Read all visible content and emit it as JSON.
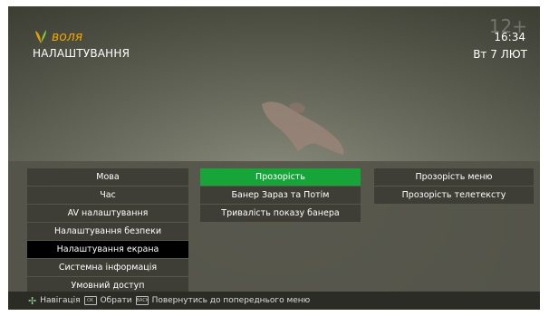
{
  "brand": {
    "name": "воля",
    "color": "#f0a500"
  },
  "header": {
    "title": "НАЛАШТУВАННЯ",
    "age_rating": "12+",
    "time": "16:34",
    "date": "Вт 7 ЛЮТ"
  },
  "menu": {
    "main_items": [
      "Мова",
      "Час",
      "AV налаштування",
      "Налаштування безпеки",
      "Налаштування екрана",
      "Системна інформація",
      "Умовний доступ"
    ],
    "main_selected_index": 4,
    "sub_items": [
      "Прозорість",
      "Банер Зараз та Потім",
      "Тривалість показу банера"
    ],
    "sub_active_index": 0,
    "detail_items": [
      "Прозорість меню",
      "Прозорість телетексту"
    ]
  },
  "help_bar": {
    "navigate_label": "Навігація",
    "ok_key": "OK",
    "select_label": "Обрати",
    "back_key": "BACK",
    "back_label": "Повернутись до попереднього меню"
  },
  "colors": {
    "active": "#17a53a",
    "selected": "#000000",
    "item_bg": "#3e3e36"
  }
}
